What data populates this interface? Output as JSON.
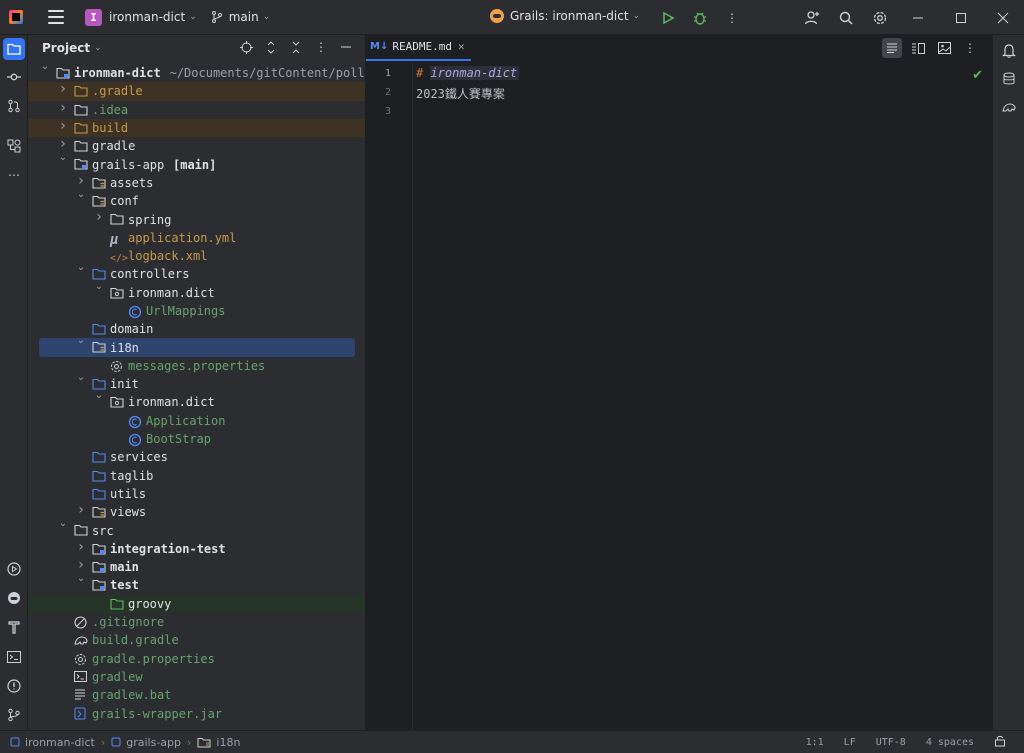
{
  "titlebar": {
    "project_badge": "I",
    "project_name": "ironman-dict",
    "branch": "main",
    "run_config": "Grails: ironman-dict"
  },
  "project_panel": {
    "title": "Project",
    "tree": [
      {
        "label": "ironman-dict",
        "suffix": "~/Documents/gitContent/pollocha",
        "depth": 0,
        "arrow": "down",
        "icon": "module-folder",
        "color": "default",
        "bold": true
      },
      {
        "label": ".gradle",
        "depth": 1,
        "arrow": "right",
        "icon": "folder-orange",
        "color": "orange",
        "bg": "excl"
      },
      {
        "label": ".idea",
        "depth": 1,
        "arrow": "right",
        "icon": "folder",
        "color": "green"
      },
      {
        "label": "build",
        "depth": 1,
        "arrow": "right",
        "icon": "folder-orange",
        "color": "orange",
        "bg": "excl"
      },
      {
        "label": "gradle",
        "depth": 1,
        "arrow": "right",
        "icon": "folder",
        "color": "default"
      },
      {
        "label": "grails-app",
        "suffix": "[main]",
        "depth": 1,
        "arrow": "down",
        "icon": "module-folder",
        "color": "default"
      },
      {
        "label": "assets",
        "depth": 2,
        "arrow": "right",
        "icon": "folder-res",
        "color": "default"
      },
      {
        "label": "conf",
        "depth": 2,
        "arrow": "down",
        "icon": "folder-res",
        "color": "default"
      },
      {
        "label": "spring",
        "depth": 3,
        "arrow": "right",
        "icon": "folder",
        "color": "default"
      },
      {
        "label": "application.yml",
        "depth": 3,
        "arrow": "",
        "icon": "yaml",
        "color": "orange"
      },
      {
        "label": "logback.xml",
        "depth": 3,
        "arrow": "",
        "icon": "xml",
        "color": "orange"
      },
      {
        "label": "controllers",
        "depth": 2,
        "arrow": "down",
        "icon": "folder-src",
        "color": "default"
      },
      {
        "label": "ironman.dict",
        "depth": 3,
        "arrow": "down",
        "icon": "package",
        "color": "default"
      },
      {
        "label": "UrlMappings",
        "depth": 4,
        "arrow": "",
        "icon": "groovy-class",
        "color": "green"
      },
      {
        "label": "domain",
        "depth": 2,
        "arrow": "",
        "icon": "folder-src",
        "color": "default"
      },
      {
        "label": "i18n",
        "depth": 2,
        "arrow": "down",
        "icon": "folder-res",
        "color": "default",
        "bg": "sel"
      },
      {
        "label": "messages.properties",
        "depth": 3,
        "arrow": "",
        "icon": "gear",
        "color": "green"
      },
      {
        "label": "init",
        "depth": 2,
        "arrow": "down",
        "icon": "folder-src",
        "color": "default"
      },
      {
        "label": "ironman.dict",
        "depth": 3,
        "arrow": "down",
        "icon": "package",
        "color": "default"
      },
      {
        "label": "Application",
        "depth": 4,
        "arrow": "",
        "icon": "groovy-class",
        "color": "green"
      },
      {
        "label": "BootStrap",
        "depth": 4,
        "arrow": "",
        "icon": "groovy-class",
        "color": "green"
      },
      {
        "label": "services",
        "depth": 2,
        "arrow": "",
        "icon": "folder-src",
        "color": "default"
      },
      {
        "label": "taglib",
        "depth": 2,
        "arrow": "",
        "icon": "folder-src",
        "color": "default"
      },
      {
        "label": "utils",
        "depth": 2,
        "arrow": "",
        "icon": "folder-src",
        "color": "default"
      },
      {
        "label": "views",
        "depth": 2,
        "arrow": "right",
        "icon": "folder-res",
        "color": "default"
      },
      {
        "label": "src",
        "depth": 1,
        "arrow": "down",
        "icon": "folder",
        "color": "default"
      },
      {
        "label": "integration-test",
        "depth": 2,
        "arrow": "right",
        "icon": "folder-module",
        "color": "default",
        "bold": true
      },
      {
        "label": "main",
        "depth": 2,
        "arrow": "right",
        "icon": "folder-module",
        "color": "default",
        "bold": true
      },
      {
        "label": "test",
        "depth": 2,
        "arrow": "down",
        "icon": "folder-module",
        "color": "default",
        "bold": true
      },
      {
        "label": "groovy",
        "depth": 3,
        "arrow": "",
        "icon": "folder-test",
        "color": "default",
        "bg": "green"
      },
      {
        "label": ".gitignore",
        "depth": 1,
        "arrow": "",
        "icon": "ignore",
        "color": "green"
      },
      {
        "label": "build.gradle",
        "depth": 1,
        "arrow": "",
        "icon": "gradle",
        "color": "green"
      },
      {
        "label": "gradle.properties",
        "depth": 1,
        "arrow": "",
        "icon": "gear",
        "color": "green"
      },
      {
        "label": "gradlew",
        "depth": 1,
        "arrow": "",
        "icon": "terminal",
        "color": "green"
      },
      {
        "label": "gradlew.bat",
        "depth": 1,
        "arrow": "",
        "icon": "text",
        "color": "green"
      },
      {
        "label": "grails-wrapper.jar",
        "depth": 1,
        "arrow": "",
        "icon": "jar",
        "color": "green"
      }
    ]
  },
  "editor": {
    "tab_label": "README.md",
    "tab_icon": "M↓",
    "line_numbers": [
      "1",
      "2",
      "3"
    ],
    "lines": {
      "l1_hash": "# ",
      "l1_heading": "ironman-dict",
      "l2": "2023鐵人賽專案",
      "l3": ""
    }
  },
  "statusbar": {
    "crumbs": [
      "ironman-dict",
      "grails-app",
      "i18n"
    ],
    "position": "1:1",
    "line_sep": "LF",
    "encoding": "UTF-8",
    "indent": "4 spaces"
  },
  "colors": {
    "accent": "#3574f0",
    "panel_bg": "#2b2d30",
    "editor_bg": "#1e1f22",
    "selection": "#2e436e",
    "excluded_bg": "#3d3223",
    "test_bg": "#263427"
  }
}
